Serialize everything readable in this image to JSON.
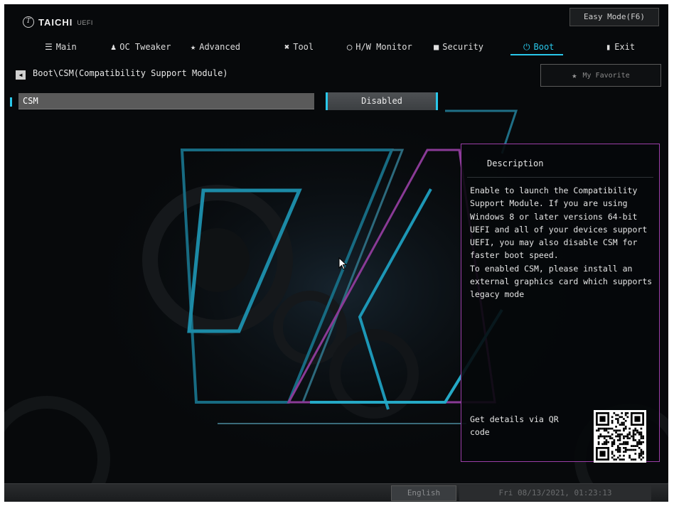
{
  "brand": {
    "logo_letter": "T",
    "name": "TAICHI",
    "suffix": "UEFI"
  },
  "header": {
    "easy_mode_label": "Easy Mode(F6)"
  },
  "nav": {
    "items": [
      {
        "label": "Main",
        "icon": "list-icon",
        "glyph": "☰"
      },
      {
        "label": "OC Tweaker",
        "icon": "person-icon",
        "glyph": "♟"
      },
      {
        "label": "Advanced",
        "icon": "star-icon",
        "glyph": "★"
      },
      {
        "label": "Tool",
        "icon": "tools-icon",
        "glyph": "✖"
      },
      {
        "label": "H/W Monitor",
        "icon": "monitor-icon",
        "glyph": "◯"
      },
      {
        "label": "Security",
        "icon": "shield-icon",
        "glyph": "■"
      },
      {
        "label": "Boot",
        "icon": "power-icon",
        "glyph": "⏻"
      },
      {
        "label": "Exit",
        "icon": "exit-icon",
        "glyph": "▮"
      }
    ],
    "active": "Boot"
  },
  "breadcrumb": "Boot\\CSM(Compatibility Support Module)",
  "favorite_label": "My Favorite",
  "setting": {
    "label": "CSM",
    "value": "Disabled"
  },
  "description": {
    "title": "Description",
    "text": "Enable to launch the Compatibility Support Module. If you are using Windows 8 or later versions 64-bit UEFI and all of your devices support UEFI, you may also disable CSM for faster boot speed.\nTo enabled CSM, please install an external graphics card which supports legacy mode",
    "qr_label": "Get details via QR code"
  },
  "footer": {
    "language": "English",
    "datetime": "Fri 08/13/2021, 01:23:13"
  },
  "colors": {
    "accent": "#29c7ea",
    "panel_border": "#9b3ea8",
    "background": "#07090b"
  }
}
